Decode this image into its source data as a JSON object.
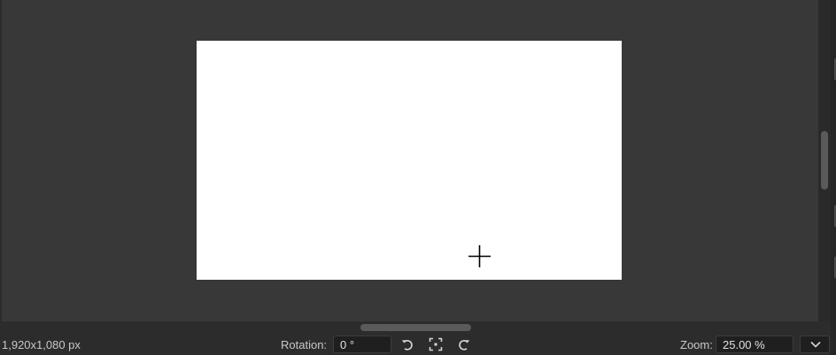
{
  "canvas": {
    "background": "#383838",
    "document_color": "#ffffff",
    "cursor_icon": "crosshair-icon"
  },
  "status_bar": {
    "dimensions": "1,920x1,080 px",
    "rotation_label": "Rotation:",
    "rotation_value": "0 °",
    "rotate_left_icon": "rotate-left-icon",
    "fit_icon": "fit-to-view-icon",
    "rotate_right_icon": "rotate-right-icon",
    "zoom_label": "Zoom:",
    "zoom_value": "25.00 %",
    "zoom_dropdown_icon": "chevron-down-icon"
  }
}
